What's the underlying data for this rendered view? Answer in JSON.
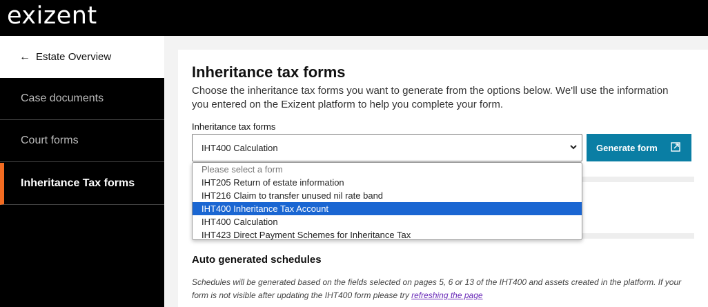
{
  "brand": {
    "logo_text": "exizent"
  },
  "sidebar": {
    "back_label": "Estate Overview",
    "items": [
      {
        "label": "Case documents",
        "active": false
      },
      {
        "label": "Court forms",
        "active": false
      },
      {
        "label": "Inheritance Tax forms",
        "active": true
      }
    ]
  },
  "main": {
    "title": "Inheritance tax forms",
    "description": "Choose the inheritance tax forms you want to generate from the options below. We'll use the information you entered on the Exizent platform to help you complete your form.",
    "select_label": "Inheritance tax forms",
    "select_value": "IHT400 Calculation",
    "generate_button": "Generate form",
    "dropdown_options": [
      "Please select a form",
      "IHT205 Return of estate information",
      "IHT216 Claim to transfer unused nil rate band",
      "IHT400 Inheritance Tax Account",
      "IHT400 Calculation",
      "IHT423 Direct Payment Schemes for Inheritance Tax"
    ],
    "highlighted_option": "IHT400 Inheritance Tax Account",
    "schedules_title": "Auto generated schedules",
    "schedules_note": "Schedules will be generated based on the fields selected on pages 5, 6 or 13 of the IHT400 and assets created in the platform. If your form is not visible after updating the IHT400 form please try ",
    "refresh_link": "refreshing the page"
  },
  "colors": {
    "accent": "#f26b21",
    "button": "#0a7ea4",
    "highlight": "#1a66d2"
  }
}
